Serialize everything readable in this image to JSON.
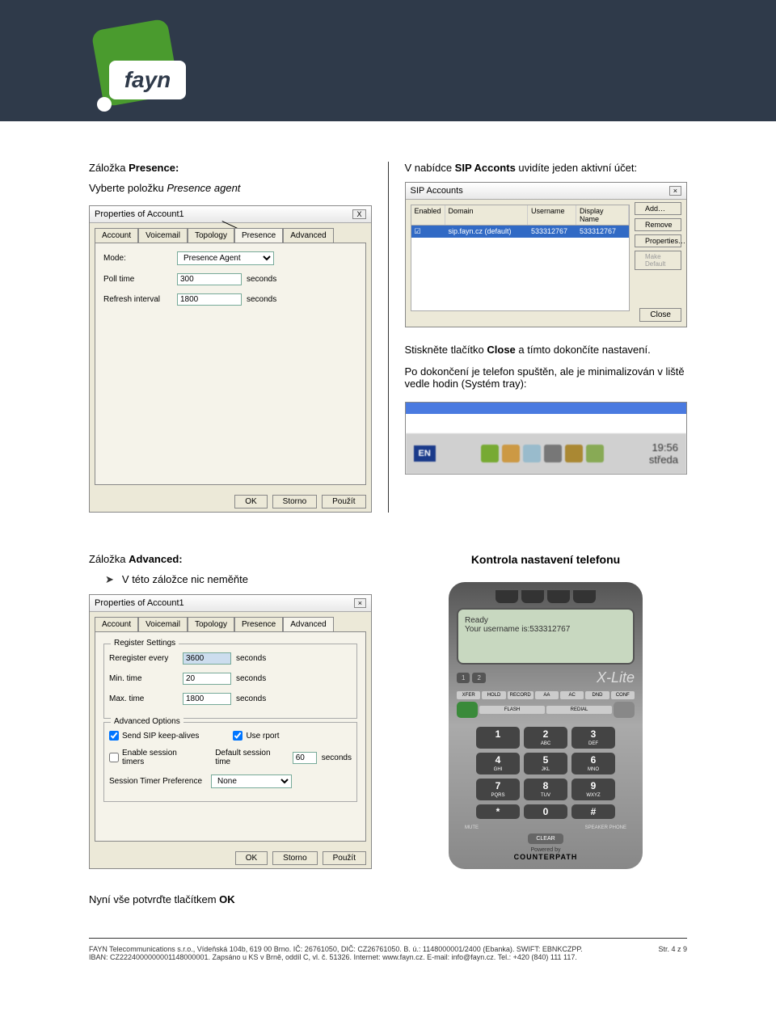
{
  "header": {
    "logo_text": "fayn"
  },
  "left": {
    "title_a": "Záložka ",
    "title_b": "Presence:",
    "subtitle_a": "Vyberte položku ",
    "subtitle_b": "Presence agent",
    "dialog": {
      "title": "Properties of Account1",
      "tabs": [
        "Account",
        "Voicemail",
        "Topology",
        "Presence",
        "Advanced"
      ],
      "mode_label": "Mode:",
      "mode_value": "Presence Agent",
      "poll_label": "Poll time",
      "poll_value": "300",
      "refresh_label": "Refresh interval",
      "refresh_value": "1800",
      "seconds": "seconds",
      "ok": "OK",
      "storno": "Storno",
      "pouzit": "Použít"
    }
  },
  "right": {
    "title_a": "V nabídce ",
    "title_b": "SIP Acconts",
    "title_c": " uvidíte jeden aktivní účet:",
    "sip": {
      "title": "SIP Accounts",
      "headers": {
        "enabled": "Enabled",
        "domain": "Domain",
        "username": "Username",
        "display": "Display Name"
      },
      "row": {
        "domain": "sip.fayn.cz (default)",
        "username": "533312767",
        "display": "533312767"
      },
      "add": "Add…",
      "remove": "Remove",
      "props": "Properties…",
      "default": "Make Default",
      "close": "Close"
    },
    "p1a": "Stiskněte tlačítko ",
    "p1b": "Close",
    "p1c": " a tímto dokončíte nastavení.",
    "p2": "Po dokončení je telefon spuštěn, ale je minimalizován v liště vedle hodin (Systém tray):",
    "tray": {
      "en": "EN",
      "time": "19:56",
      "day": "středa"
    }
  },
  "sec2": {
    "left": {
      "title_a": "Záložka ",
      "title_b": "Advanced:",
      "bullet": "V této záložce nic neměňte",
      "dialog": {
        "title": "Properties of Account1",
        "tabs": [
          "Account",
          "Voicemail",
          "Topology",
          "Presence",
          "Advanced"
        ],
        "fs1": "Register Settings",
        "rereg_label": "Reregister every",
        "rereg_value": "3600",
        "min_label": "Min. time",
        "min_value": "20",
        "max_label": "Max. time",
        "max_value": "1800",
        "fs2": "Advanced Options",
        "keepalive": "Send SIP keep-alives",
        "rport": "Use rport",
        "sesstimers": "Enable session timers",
        "defsess_label": "Default session time",
        "defsess_value": "60",
        "pref_label": "Session Timer Preference",
        "pref_value": "None",
        "seconds": "seconds",
        "ok": "OK",
        "storno": "Storno",
        "pouzit": "Použít"
      },
      "confirm_a": "Nyní vše potvrďte tlačítkem ",
      "confirm_b": "OK"
    },
    "right": {
      "heading": "Kontrola  nastavení telefonu",
      "phone": {
        "ready": "Ready",
        "username": "Your username is:533312767",
        "lines": [
          "1",
          "2"
        ],
        "xlite": "X-Lite",
        "fns1": [
          "XFER",
          "HOLD",
          "RECORD",
          "AA",
          "AC",
          "DND",
          "CONF"
        ],
        "fns2_left": "FLASH",
        "fns2_right": "REDIAL",
        "keys": [
          {
            "n": "1",
            "l": ""
          },
          {
            "n": "2",
            "l": "ABC"
          },
          {
            "n": "3",
            "l": "DEF"
          },
          {
            "n": "4",
            "l": "GHI"
          },
          {
            "n": "5",
            "l": "JKL"
          },
          {
            "n": "6",
            "l": "MNO"
          },
          {
            "n": "7",
            "l": "PQRS"
          },
          {
            "n": "8",
            "l": "TUV"
          },
          {
            "n": "9",
            "l": "WXYZ"
          },
          {
            "n": "*",
            "l": ""
          },
          {
            "n": "0",
            "l": ""
          },
          {
            "n": "#",
            "l": ""
          }
        ],
        "mute": "MUTE",
        "speaker": "SPEAKER PHONE",
        "clear": "CLEAR",
        "powered": "Powered by",
        "cp": "COUNTERPATH"
      }
    }
  },
  "footer": {
    "line1": "FAYN Telecommunications s.r.o., Vídeňská 104b, 619 00 Brno. IČ: 26761050, DIČ: CZ26761050. B. ú.: 1148000001/2400 (Ebanka). SWIFT: EBNKCZPP.",
    "line2": "IBAN: CZ2224000000001148000001. Zapsáno u KS v Brně, oddíl C, vl. č. 51326. Internet: www.fayn.cz. E-mail: info@fayn.cz. Tel.: +420 (840) 111 117.",
    "page": "Str. 4 z 9"
  }
}
